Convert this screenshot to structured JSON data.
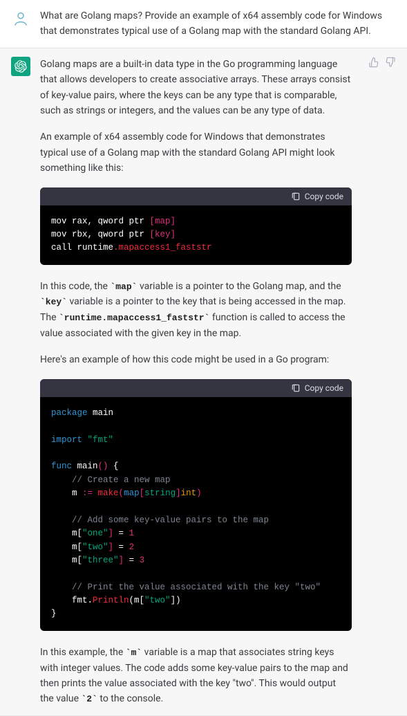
{
  "user": {
    "question": "What are Golang maps? Provide an example of x64 assembly code for Windows that demonstrates typical use of a Golang map with the standard Golang API."
  },
  "assistant": {
    "p1": "Golang maps are a built-in data type in the Go programming language that allows developers to create associative arrays. These arrays consist of key-value pairs, where the keys can be any type that is comparable, such as strings or integers, and the values can be any type of data.",
    "p2": "An example of x64 assembly code for Windows that demonstrates typical use of a Golang map with the standard Golang API might look something like this:",
    "code1_copy": "Copy code",
    "p3_a": "In this code, the ",
    "p3_map": "`map`",
    "p3_b": " variable is a pointer to the Golang map, and the ",
    "p3_key": "`key`",
    "p3_c": " variable is a pointer to the key that is being accessed in the map. The ",
    "p3_fn": "`runtime.mapaccess1_faststr`",
    "p3_d": " function is called to access the value associated with the given key in the map.",
    "p4": "Here's an example of how this code might be used in a Go program:",
    "code2_copy": "Copy code",
    "p5_a": "In this example, the ",
    "p5_m": "`m`",
    "p5_b": " variable is a map that associates string keys with integer values. The code adds some key-value pairs to the map and then prints the value associated with the key \"two\". This would output the value ",
    "p5_2": "`2`",
    "p5_c": " to the console."
  },
  "asm": {
    "l1_a": "mov rax, qword ptr ",
    "l1_b": "[map]",
    "l2_a": "mov rbx, qword ptr ",
    "l2_b": "[key]",
    "l3_a": "call runtime",
    "l3_b": ".mapaccess1_faststr"
  },
  "go": {
    "l1_a": "package",
    "l1_b": " main",
    "l2_a": "import",
    "l2_b": " \"fmt\"",
    "l3_a": "func",
    "l3_b": " main",
    "l3_c": "()",
    "l3_d": " {",
    "l4": "    // Create a new map",
    "l5_a": "    m ",
    "l5_b": ":=",
    "l5_c": " make",
    "l5_d": "(",
    "l5_e": "map",
    "l5_f": "[",
    "l5_g": "string",
    "l5_h": "]",
    "l5_i": "int",
    "l5_j": ")",
    "l6": "    // Add some key-value pairs to the map",
    "l7_a": "    m[",
    "l7_b": "\"one\"",
    "l7_c": "]",
    "l7_d": " = ",
    "l7_e": "1",
    "l8_a": "    m[",
    "l8_b": "\"two\"",
    "l8_c": "]",
    "l8_d": " = ",
    "l8_e": "2",
    "l9_a": "    m[",
    "l9_b": "\"three\"",
    "l9_c": "]",
    "l9_d": " = ",
    "l9_e": "3",
    "l10": "    // Print the value associated with the key \"two\"",
    "l11_a": "    fmt.",
    "l11_b": "Println",
    "l11_c": "(m[",
    "l11_d": "\"two\"",
    "l11_e": "])",
    "l12": "}"
  }
}
